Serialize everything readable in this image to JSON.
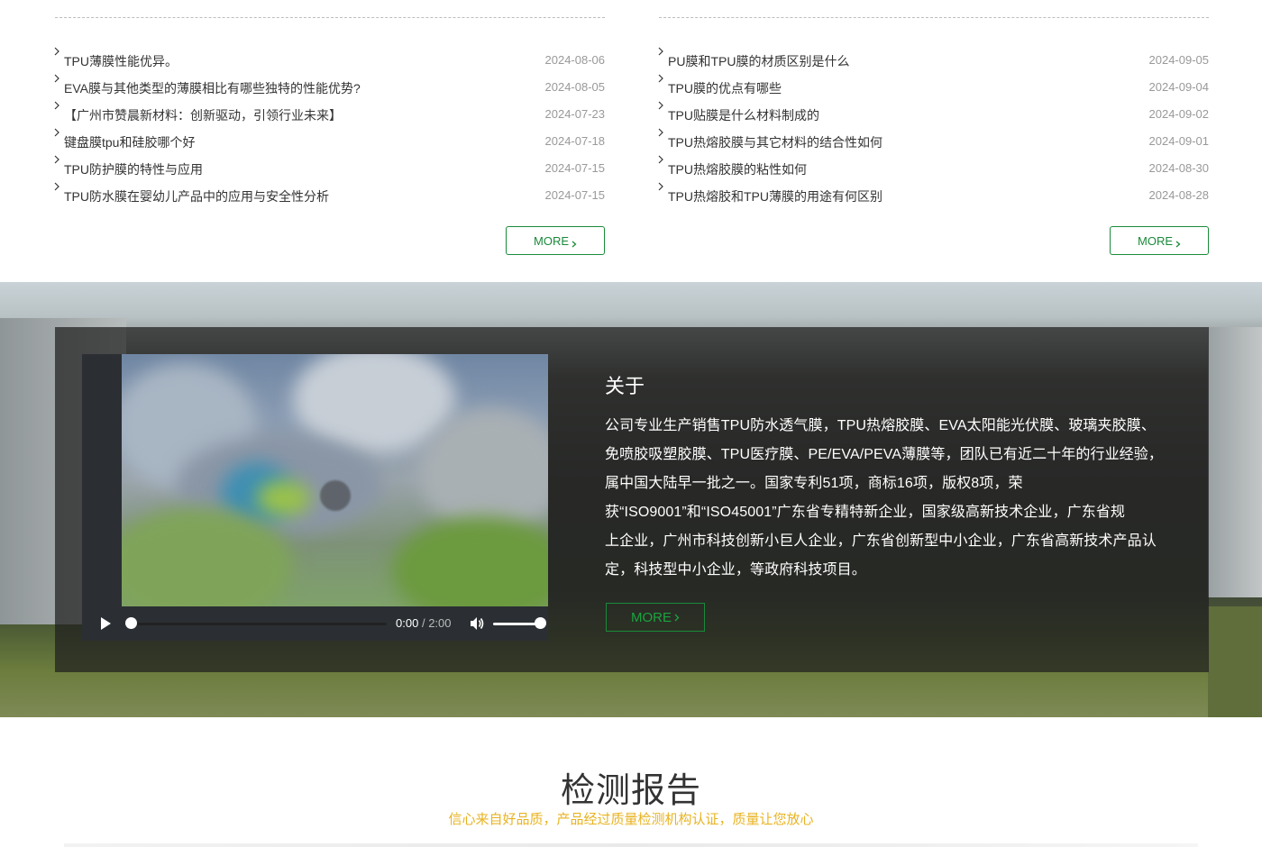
{
  "news_left": {
    "items": [
      {
        "title": "TPU薄膜性能优异。",
        "date": "2024-08-06"
      },
      {
        "title": "EVA膜与其他类型的薄膜相比有哪些独特的性能优势?",
        "date": "2024-08-05"
      },
      {
        "title": "【广州市赞晨新材料：创新驱动，引领行业未来】",
        "date": "2024-07-23"
      },
      {
        "title": "键盘膜tpu和硅胶哪个好",
        "date": "2024-07-18"
      },
      {
        "title": "TPU防护膜的特性与应用",
        "date": "2024-07-15"
      },
      {
        "title": "TPU防水膜在婴幼儿产品中的应用与安全性分析",
        "date": "2024-07-15"
      }
    ],
    "more_label": "MORE"
  },
  "news_right": {
    "items": [
      {
        "title": "PU膜和TPU膜的材质区别是什么",
        "date": "2024-09-05"
      },
      {
        "title": "TPU膜的优点有哪些",
        "date": "2024-09-04"
      },
      {
        "title": "TPU贴膜是什么材料制成的",
        "date": "2024-09-02"
      },
      {
        "title": "TPU热熔胶膜与其它材料的结合性如何",
        "date": "2024-09-01"
      },
      {
        "title": "TPU热熔胶膜的粘性如何",
        "date": "2024-08-30"
      },
      {
        "title": "TPU热熔胶和TPU薄膜的用途有何区别",
        "date": "2024-08-28"
      }
    ],
    "more_label": "MORE"
  },
  "about": {
    "title": "关于",
    "lines": [
      "公司专业生产销售TPU防水透气膜，TPU热熔胶膜、EVA太阳能光伏膜、玻璃夹胶膜、",
      "免喷胶吸塑胶膜、TPU医疗膜、PE/EVA/PEVA薄膜等，团队已有近二十年的行业经验，",
      "属中国大陆早一批之一。国家专利51项，商标16项，版权8项，荣",
      "获“ISO9001”和“ISO45001”广东省专精特新企业，国家级高新技术企业，广东省规",
      "上企业，广州市科技创新小巨人企业，广东省创新型中小企业，广东省高新技术产品认",
      "定，科技型中小企业，等政府科技项目。"
    ],
    "more_label": "MORE",
    "video": {
      "current_time": "0:00",
      "separator": "/",
      "duration": "2:00",
      "progress": 0,
      "volume": 1
    }
  },
  "report": {
    "title": "检测报告",
    "subtitle": "信心来自好品质，产品经过质量检测机构认证，质量让您放心"
  },
  "colors": {
    "accent_green": "#1a8a3a",
    "subtitle_gold": "#e8b321",
    "date_gray": "#999999"
  }
}
